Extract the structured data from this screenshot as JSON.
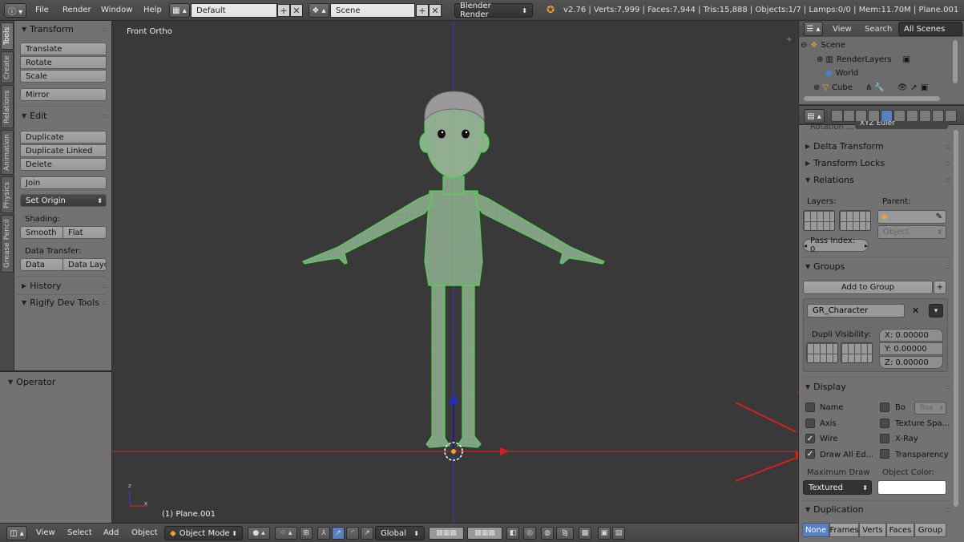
{
  "topbar": {
    "menu": [
      "File",
      "Render",
      "Window",
      "Help"
    ],
    "screen_layout": "Default",
    "scene": "Scene",
    "engine": "Blender Render",
    "stats": "v2.76 | Verts:7,999 | Faces:7,944 | Tris:15,888 | Objects:1/7 | Lamps:0/0 | Mem:11.70M | Plane.001"
  },
  "tool_tabs": [
    "Tools",
    "Create",
    "Relations",
    "Animation",
    "Physics",
    "Grease Pencil"
  ],
  "toolshelf": {
    "transform_title": "Transform",
    "translate": "Translate",
    "rotate": "Rotate",
    "scale": "Scale",
    "mirror": "Mirror",
    "edit_title": "Edit",
    "duplicate": "Duplicate",
    "duplicate_linked": "Duplicate Linked",
    "delete": "Delete",
    "join": "Join",
    "set_origin": "Set Origin",
    "shading_label": "Shading:",
    "smooth": "Smooth",
    "flat": "Flat",
    "data_transfer_label": "Data Transfer:",
    "data": "Data",
    "data_layout": "Data Layo",
    "history_title": "History",
    "rigify_title": "Rigify Dev Tools"
  },
  "operator_title": "Operator",
  "viewport": {
    "view_name": "Front Ortho",
    "object_label": "(1) Plane.001",
    "wire_color": "#4fd64f"
  },
  "bottombar": {
    "view": "View",
    "select": "Select",
    "add": "Add",
    "object": "Object",
    "mode": "Object Mode",
    "orientation": "Global"
  },
  "outliner": {
    "view": "View",
    "search": "Search",
    "filter": "All Scenes",
    "items": [
      "Scene",
      "RenderLayers",
      "World",
      "Cube"
    ]
  },
  "properties": {
    "rotation_mode_label": "Rotation ...",
    "rotation_mode_value": "XYZ Euler",
    "delta_transform": "Delta Transform",
    "transform_locks": "Transform Locks",
    "relations": "Relations",
    "layers_label": "Layers:",
    "parent_label": "Parent:",
    "parent_type": "Object",
    "pass_index": "Pass Index: 0",
    "groups": "Groups",
    "add_to_group": "Add to Group",
    "group_name": "GR_Character",
    "dupli_visibility": "Dupli Visibility:",
    "x": "X:  0.00000",
    "y": "Y:  0.00000",
    "z": "Z:  0.00000",
    "display": "Display",
    "name": "Name",
    "bounds": "Bo",
    "bounds_type": "Box",
    "axis": "Axis",
    "texture_space": "Texture Spa...",
    "wire": "Wire",
    "xray": "X-Ray",
    "draw_all_edges": "Draw All Ed...",
    "transparency": "Transparency",
    "max_draw_label": "Maximum Draw",
    "max_draw_value": "Textured",
    "object_color_label": "Object Color:",
    "object_color": "#ffffff",
    "duplication": "Duplication",
    "dup_modes": [
      "None",
      "Frames",
      "Verts",
      "Faces",
      "Group"
    ]
  },
  "checkboxes": {
    "name": false,
    "axis": false,
    "wire": true,
    "draw_all_edges": true,
    "bounds": false,
    "texture_space": false,
    "xray": false,
    "transparency": false
  },
  "annotation_color": "#d42020",
  "accent_color": "#5680c2"
}
